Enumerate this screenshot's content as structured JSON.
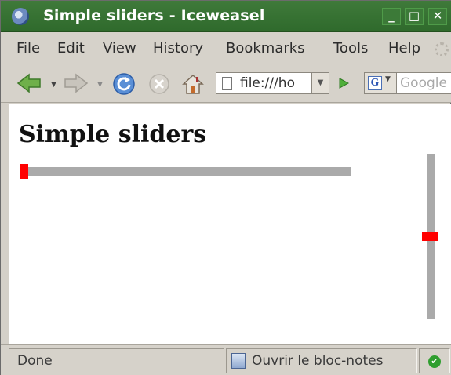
{
  "window": {
    "title": "Simple sliders - Iceweasel",
    "buttons": {
      "minimize": "_",
      "maximize": "□",
      "close": "✕"
    }
  },
  "menu": {
    "items": [
      "File",
      "Edit",
      "View",
      "History",
      "Bookmarks",
      "Tools",
      "Help"
    ]
  },
  "toolbar": {
    "icons": [
      "back-icon",
      "forward-icon",
      "reload-icon",
      "stop-icon",
      "home-icon",
      "go-icon"
    ],
    "url": "file:///ho",
    "search_engine_letter": "G",
    "search_placeholder": "Google"
  },
  "page": {
    "heading": "Simple sliders",
    "horizontal_slider": {
      "value_fraction": 0.0
    },
    "vertical_slider": {
      "value_fraction": 0.5
    },
    "colors": {
      "track": "#aaaaaa",
      "thumb": "#ff0000"
    }
  },
  "status": {
    "text": "Done",
    "notepad": "Ouvrir le bloc-notes",
    "ok": "✔"
  }
}
